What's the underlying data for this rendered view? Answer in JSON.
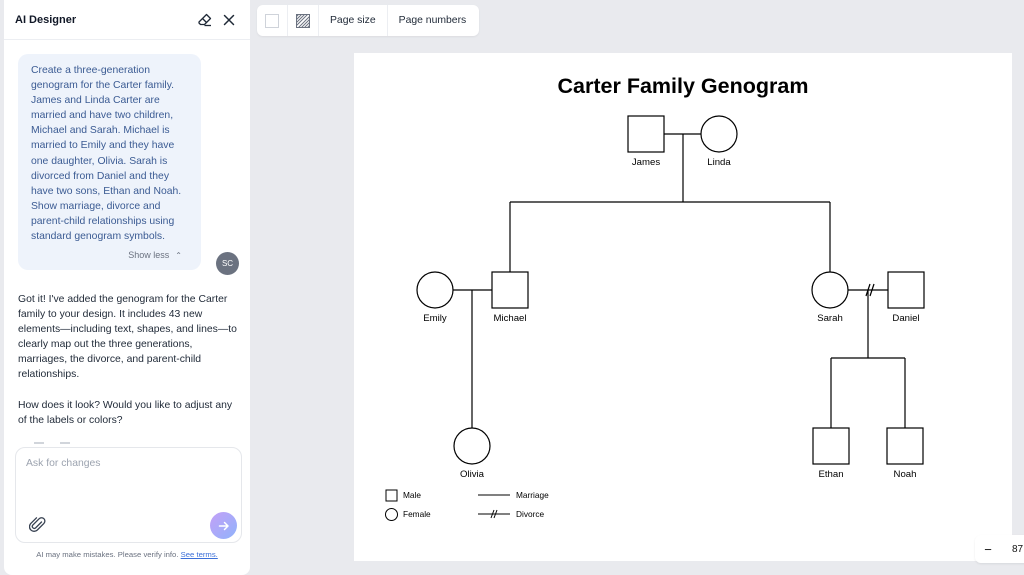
{
  "panel": {
    "title": "AI Designer",
    "user_message": "Create a three-generation genogram for the Carter family. James and Linda Carter are married and have two children, Michael and Sarah. Michael is married to Emily and they have one daughter, Olivia. Sarah is divorced from Daniel and they have two sons, Ethan and Noah. Show marriage, divorce and parent-child relationships using standard genogram symbols.",
    "show_less": "Show less",
    "avatar_initials": "SC",
    "ai_message_1": "Got it! I've added the genogram for the Carter family to your design. It includes 43 new elements—including text, shapes, and lines—to clearly map out the three generations, marriages, the divorce, and parent-child relationships.",
    "ai_message_2": "How does it look? Would you like to adjust any of the labels or colors?",
    "input_placeholder": "Ask for changes",
    "disclaimer": "AI may make mistakes. Please verify info.",
    "terms_link": "See terms."
  },
  "toolbar": {
    "page_size": "Page size",
    "page_numbers": "Page numbers"
  },
  "canvas": {
    "title": "Carter Family Genogram",
    "people": {
      "james": "James",
      "linda": "Linda",
      "emily": "Emily",
      "michael": "Michael",
      "sarah": "Sarah",
      "daniel": "Daniel",
      "olivia": "Olivia",
      "ethan": "Ethan",
      "noah": "Noah"
    },
    "legend": {
      "male": "Male",
      "female": "Female",
      "marriage": "Marriage",
      "divorce": "Divorce"
    }
  },
  "zoom": {
    "minus": "−",
    "value": "87"
  },
  "colors": {
    "user_bubble": "#eef3fb",
    "user_text": "#3b5b93",
    "link": "#3b6fd8"
  }
}
